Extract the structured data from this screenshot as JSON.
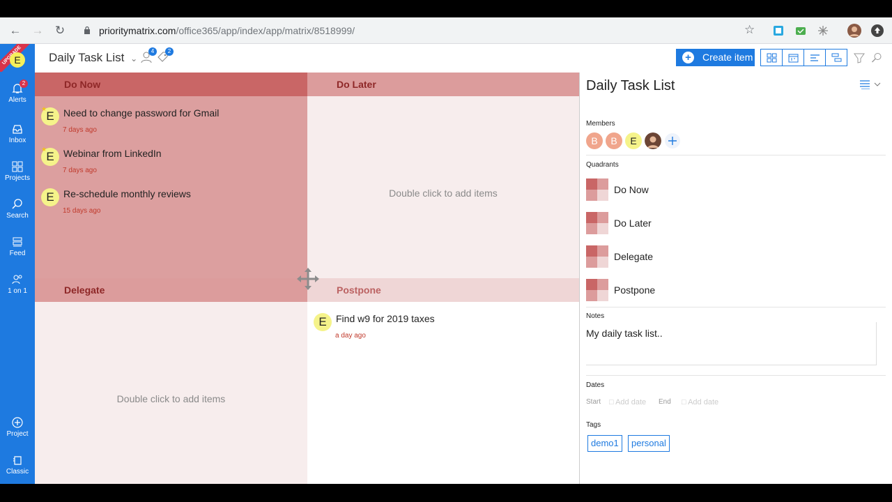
{
  "browser": {
    "url_host": "prioritymatrix.com",
    "url_path": "/office365/app/index/app/matrix/8518999/"
  },
  "sidebar": {
    "upgrade_label": "UPGRADE",
    "user_initial": "E",
    "items": [
      {
        "label": "Alerts",
        "icon": "bell-icon",
        "badge": "2"
      },
      {
        "label": "Inbox",
        "icon": "inbox-icon"
      },
      {
        "label": "Projects",
        "icon": "grid-icon"
      },
      {
        "label": "Search",
        "icon": "search-icon"
      },
      {
        "label": "Feed",
        "icon": "feed-icon"
      },
      {
        "label": "1 on 1",
        "icon": "one-on-one-icon"
      }
    ],
    "bottom_items": [
      {
        "label": "Project",
        "icon": "add-project-icon"
      },
      {
        "label": "Classic",
        "icon": "classic-icon"
      }
    ]
  },
  "header": {
    "project_title": "Daily Task List",
    "members_badge": "4",
    "tags_badge": "2",
    "create_label": "Create item"
  },
  "matrix": {
    "quadrants": {
      "do_now": {
        "title": "Do Now",
        "tasks": [
          {
            "initial": "E",
            "title": "Need to change password for Gmail",
            "age": "7 days ago",
            "starred": true
          },
          {
            "initial": "E",
            "title": "Webinar from LinkedIn",
            "age": "7 days ago",
            "starred": true
          },
          {
            "initial": "E",
            "title": "Re-schedule monthly reviews",
            "age": "15 days ago",
            "starred": false
          }
        ]
      },
      "do_later": {
        "title": "Do Later",
        "empty_hint": "Double click to add items"
      },
      "delegate": {
        "title": "Delegate",
        "empty_hint": "Double click to add items"
      },
      "postpone": {
        "title": "Postpone",
        "tasks": [
          {
            "initial": "E",
            "title": "Find w9 for 2019 taxes",
            "age": "a day ago"
          }
        ]
      }
    }
  },
  "panel": {
    "title": "Daily Task List",
    "members_label": "Members",
    "members": [
      {
        "initial": "B",
        "color": "#f0a58c"
      },
      {
        "initial": "B",
        "color": "#f0a58c"
      },
      {
        "initial": "E",
        "color": "#f5f38a"
      }
    ],
    "quadrants_label": "Quadrants",
    "quadrants": [
      "Do Now",
      "Do Later",
      "Delegate",
      "Postpone"
    ],
    "notes_label": "Notes",
    "notes": "My daily task list..",
    "dates_label": "Dates",
    "start_label": "Start",
    "start_add": "Add date",
    "end_label": "End",
    "end_add": "Add date",
    "tags_label": "Tags",
    "tags": [
      "demo1",
      "personal"
    ]
  },
  "colors": {
    "accent": "#1e7ae0",
    "do_now_bg": "#dc9f9f",
    "do_now_header": "#c96666"
  }
}
